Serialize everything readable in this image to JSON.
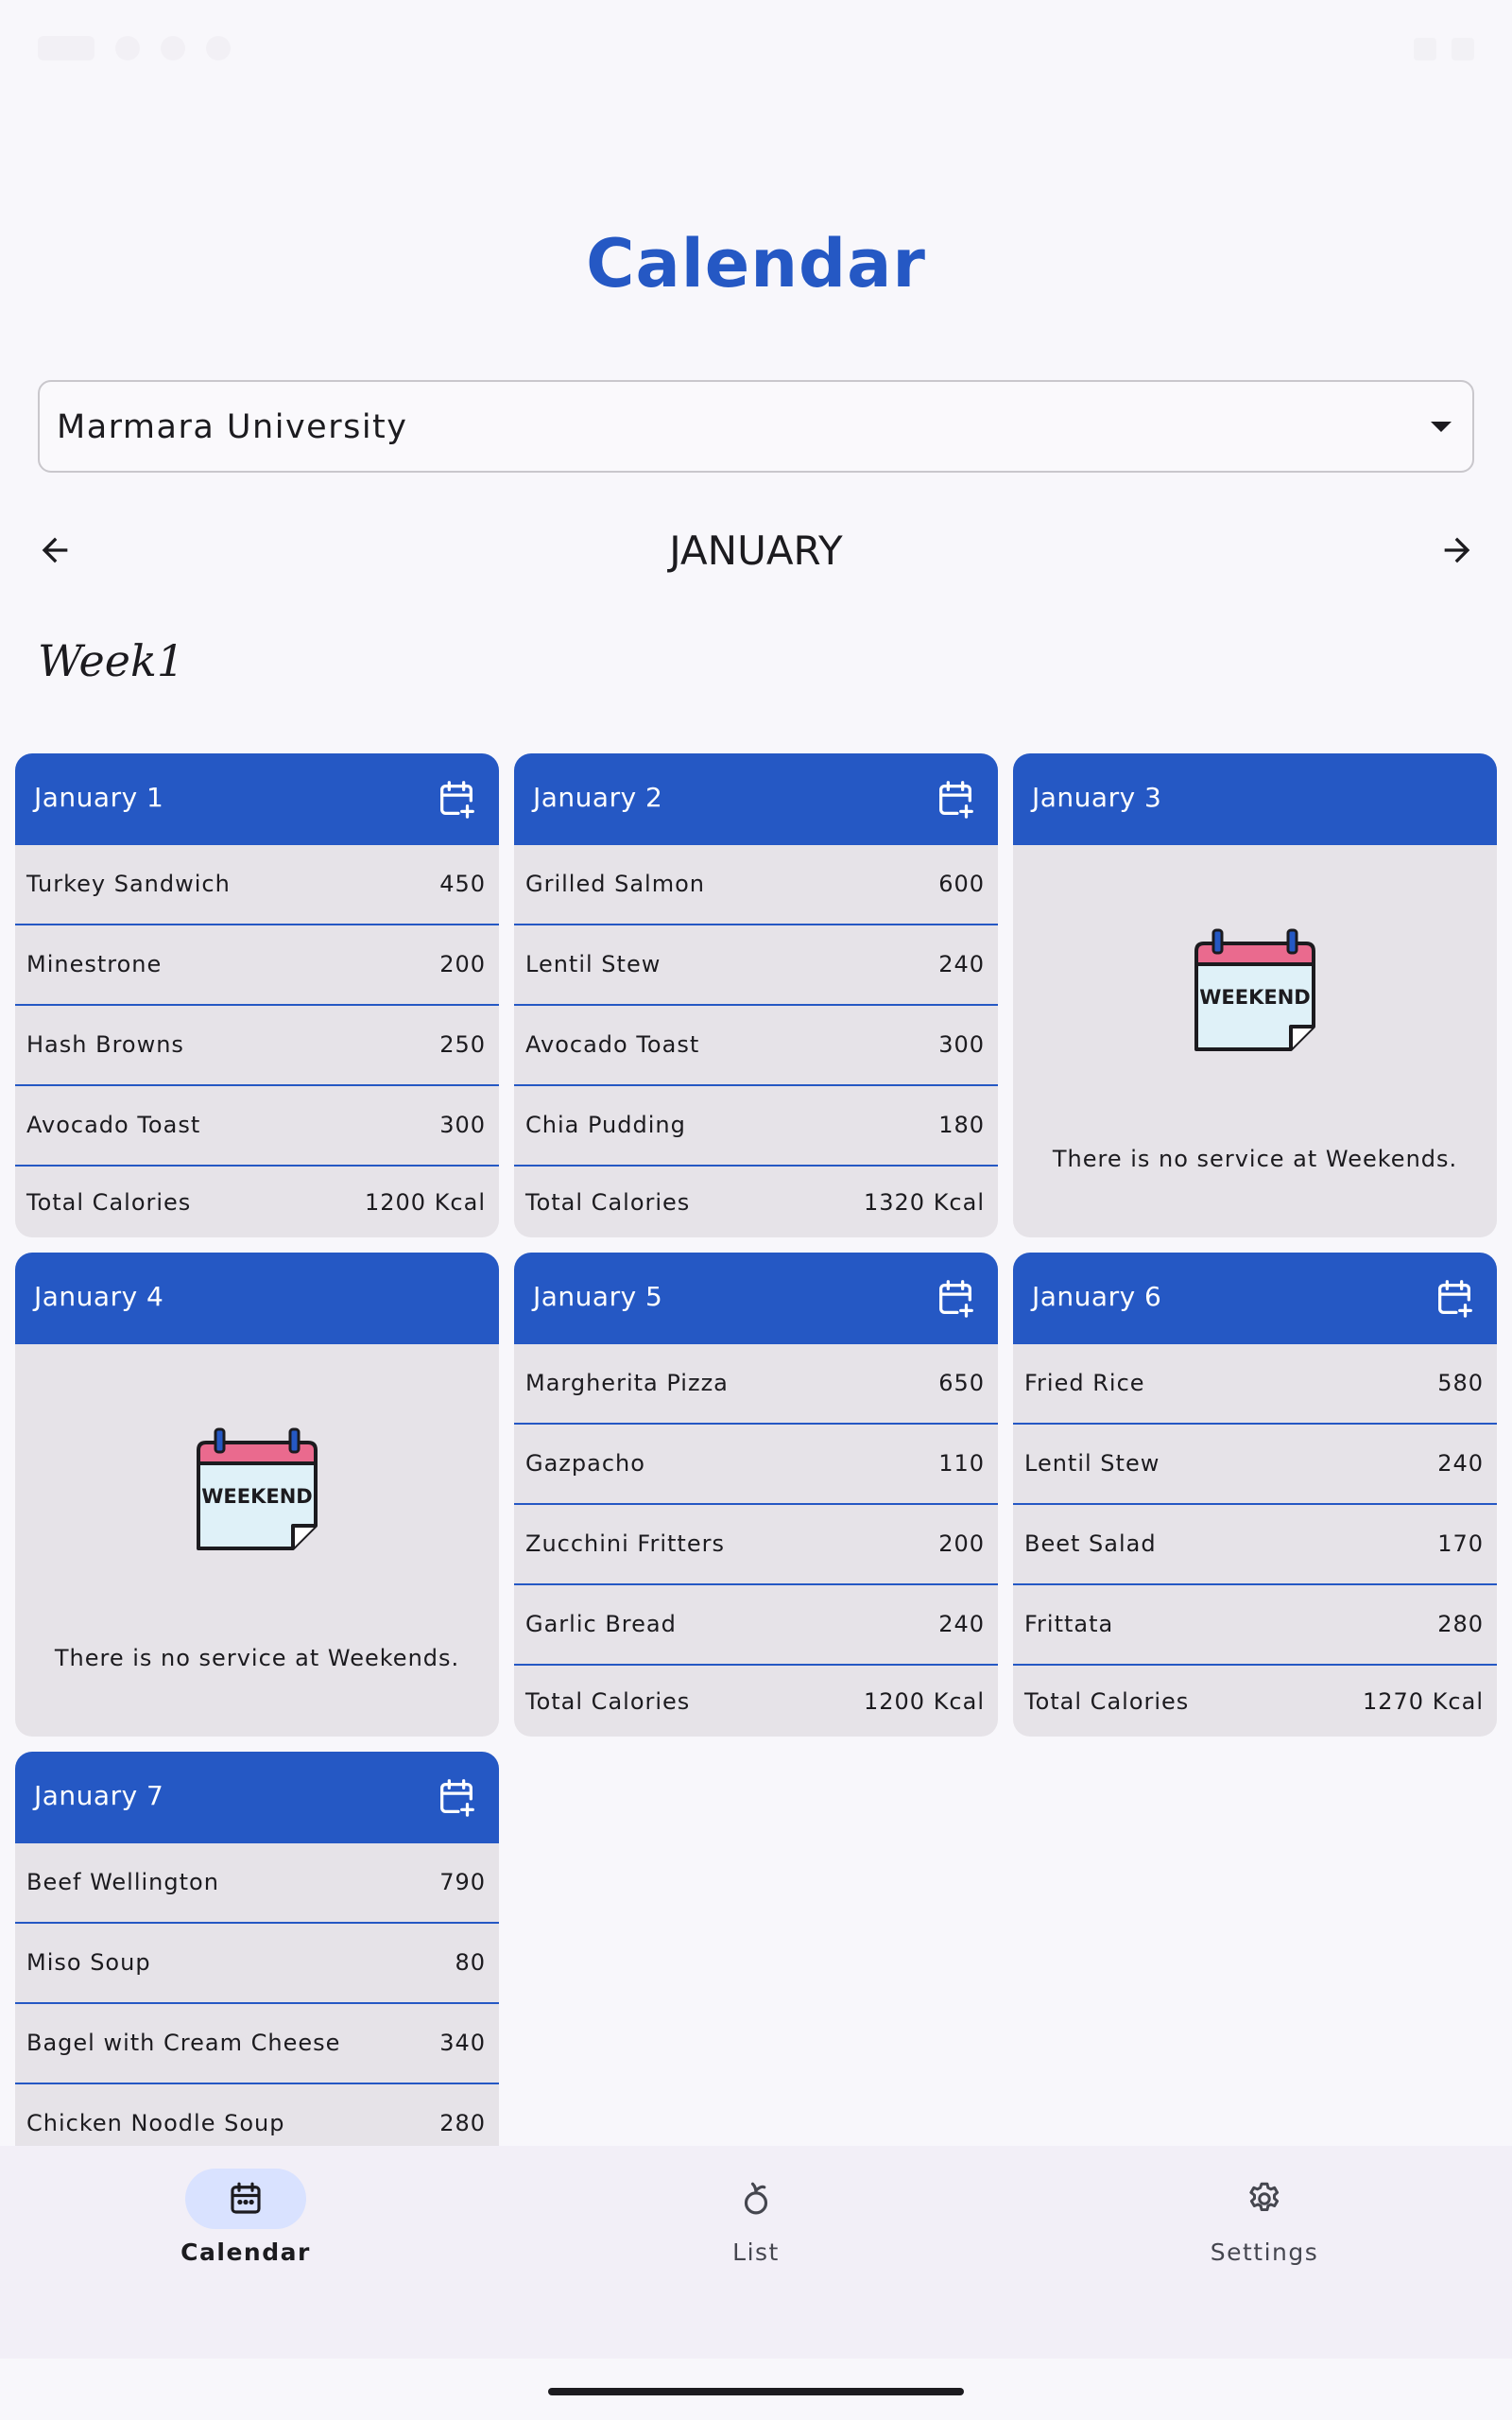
{
  "page": {
    "title": "Calendar"
  },
  "university_select": {
    "value": "Marmara University"
  },
  "month_nav": {
    "month": "JANUARY"
  },
  "week": {
    "label": "Week1"
  },
  "colors": {
    "primary": "#2558c4",
    "card_bg": "#e6e3e8",
    "nav_bg": "#f2eff7",
    "active_pill": "#d9e2ff",
    "weekend_pink": "#ea6a8e",
    "weekend_paper": "#dff1f8"
  },
  "days": [
    {
      "date": "January 1",
      "weekend": false,
      "meals": [
        {
          "name": "Turkey Sandwich",
          "calories": "450"
        },
        {
          "name": "Minestrone",
          "calories": "200"
        },
        {
          "name": "Hash Browns",
          "calories": "250"
        },
        {
          "name": "Avocado Toast",
          "calories": "300"
        }
      ],
      "total_label": "Total Calories",
      "total": "1200 Kcal"
    },
    {
      "date": "January 2",
      "weekend": false,
      "meals": [
        {
          "name": "Grilled Salmon",
          "calories": "600"
        },
        {
          "name": "Lentil Stew",
          "calories": "240"
        },
        {
          "name": "Avocado Toast",
          "calories": "300"
        },
        {
          "name": "Chia Pudding",
          "calories": "180"
        }
      ],
      "total_label": "Total Calories",
      "total": "1320 Kcal"
    },
    {
      "date": "January 3",
      "weekend": true,
      "weekend_badge": "WEEKEND",
      "message": "There is no service at Weekends."
    },
    {
      "date": "January 4",
      "weekend": true,
      "weekend_badge": "WEEKEND",
      "message": "There is no service at Weekends."
    },
    {
      "date": "January 5",
      "weekend": false,
      "meals": [
        {
          "name": "Margherita Pizza",
          "calories": "650"
        },
        {
          "name": "Gazpacho",
          "calories": "110"
        },
        {
          "name": "Zucchini Fritters",
          "calories": "200"
        },
        {
          "name": "Garlic Bread",
          "calories": "240"
        }
      ],
      "total_label": "Total Calories",
      "total": "1200 Kcal"
    },
    {
      "date": "January 6",
      "weekend": false,
      "meals": [
        {
          "name": "Fried Rice",
          "calories": "580"
        },
        {
          "name": "Lentil Stew",
          "calories": "240"
        },
        {
          "name": "Beet Salad",
          "calories": "170"
        },
        {
          "name": "Frittata",
          "calories": "280"
        }
      ],
      "total_label": "Total Calories",
      "total": "1270 Kcal"
    },
    {
      "date": "January 7",
      "weekend": false,
      "meals": [
        {
          "name": "Beef Wellington",
          "calories": "790"
        },
        {
          "name": "Miso Soup",
          "calories": "80"
        },
        {
          "name": "Bagel with Cream Cheese",
          "calories": "340"
        },
        {
          "name": "Chicken Noodle Soup",
          "calories": "280"
        }
      ]
    }
  ],
  "bottom_nav": [
    {
      "label": "Calendar",
      "icon": "calendar-icon",
      "active": true
    },
    {
      "label": "List",
      "icon": "apple-icon",
      "active": false
    },
    {
      "label": "Settings",
      "icon": "gear-icon",
      "active": false
    }
  ]
}
